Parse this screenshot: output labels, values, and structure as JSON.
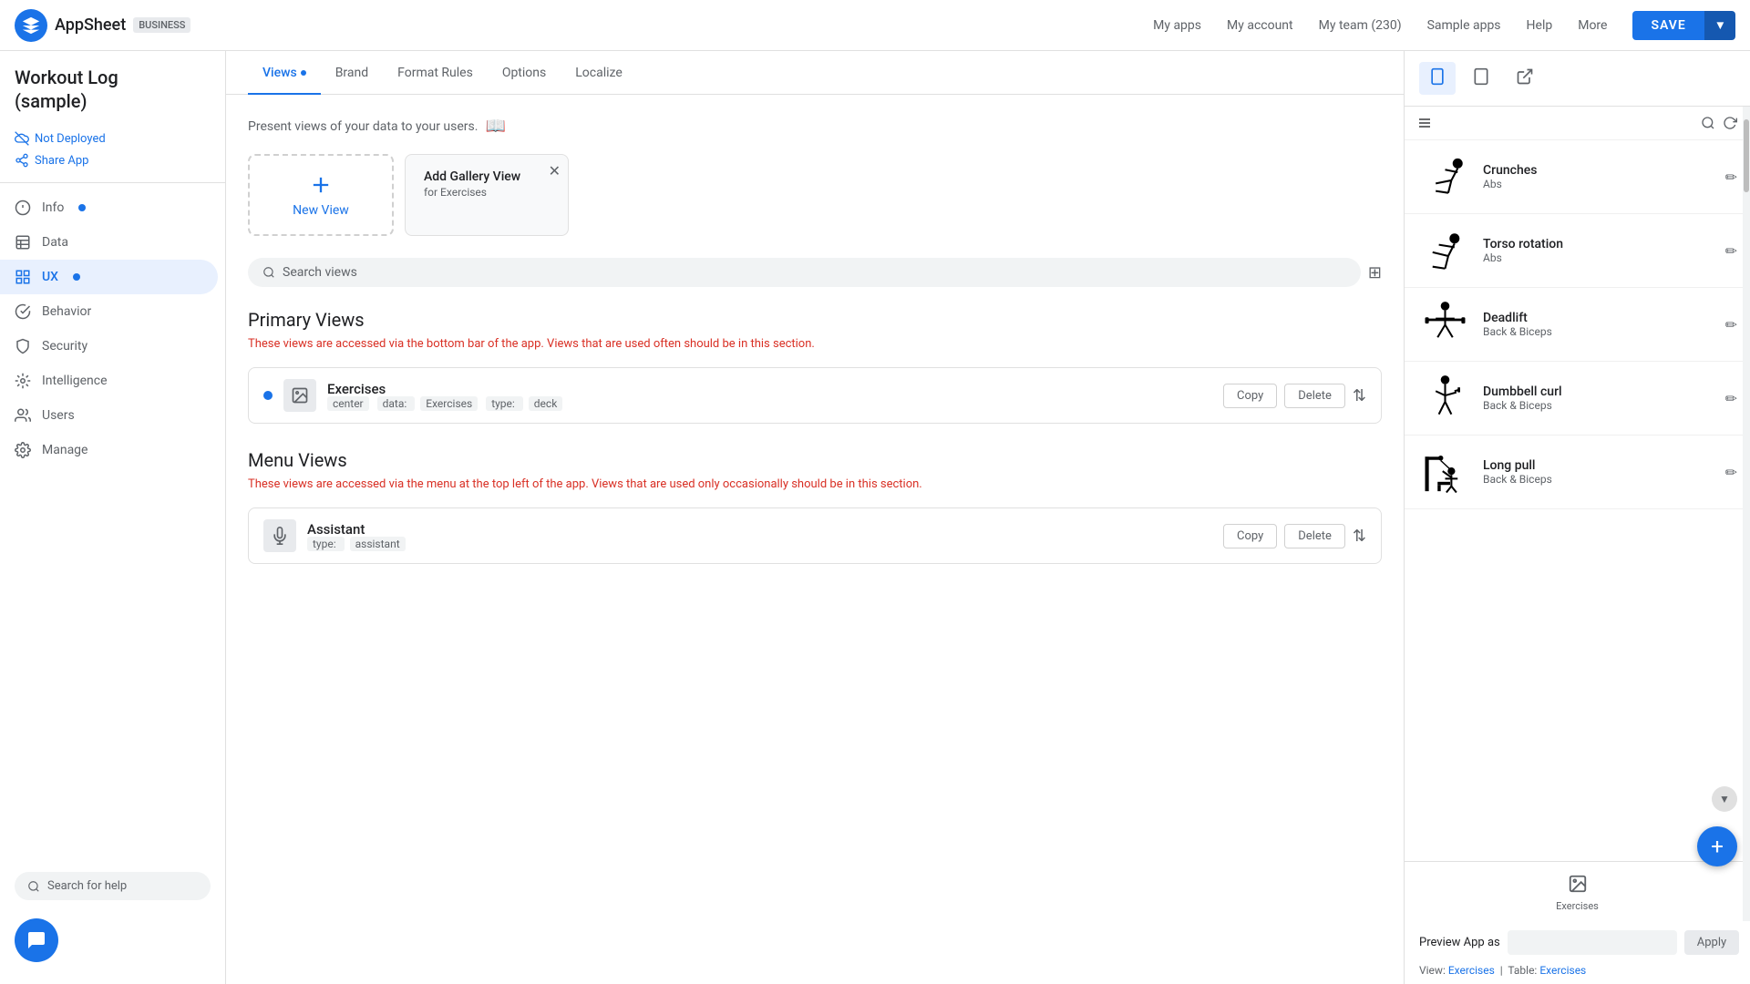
{
  "app": {
    "name": "Workout Log",
    "name_sub": "(sample)",
    "badge": "BUSINESS",
    "status": "Not Deployed",
    "share": "Share App"
  },
  "top_nav": {
    "my_apps": "My apps",
    "my_account": "My account",
    "my_team": "My team (230)",
    "sample_apps": "Sample apps",
    "help": "Help",
    "more": "More",
    "save": "SAVE"
  },
  "sidebar": {
    "items": [
      {
        "id": "info",
        "label": "Info",
        "has_dot": true
      },
      {
        "id": "data",
        "label": "Data",
        "has_dot": false
      },
      {
        "id": "ux",
        "label": "UX",
        "has_dot": true,
        "active": true
      },
      {
        "id": "behavior",
        "label": "Behavior",
        "has_dot": false
      },
      {
        "id": "security",
        "label": "Security",
        "has_dot": false
      },
      {
        "id": "intelligence",
        "label": "Intelligence",
        "has_dot": false
      },
      {
        "id": "users",
        "label": "Users",
        "has_dot": false
      },
      {
        "id": "manage",
        "label": "Manage",
        "has_dot": false
      }
    ],
    "search_placeholder": "Search for help"
  },
  "content": {
    "tabs": [
      {
        "id": "views",
        "label": "Views",
        "active": true,
        "has_dot": true
      },
      {
        "id": "brand",
        "label": "Brand",
        "active": false
      },
      {
        "id": "format_rules",
        "label": "Format Rules",
        "active": false
      },
      {
        "id": "options",
        "label": "Options",
        "active": false
      },
      {
        "id": "localize",
        "label": "Localize",
        "active": false
      }
    ],
    "description": "Present views of your data to your users.",
    "add_gallery_view": {
      "title": "Add Gallery View",
      "subtitle": "for Exercises"
    },
    "new_view_label": "New View",
    "search_placeholder": "Search views",
    "primary_views": {
      "title": "Primary Views",
      "description": "These views are accessed via the bottom bar of the app. Views that are used often should be in this section.",
      "items": [
        {
          "name": "Exercises",
          "center": "center",
          "data": "Exercises",
          "type": "deck",
          "has_dot": true
        }
      ]
    },
    "menu_views": {
      "title": "Menu Views",
      "description": "These views are accessed via the menu at the top left of the app. Views that are used only occasionally should be in this section.",
      "items": [
        {
          "name": "Assistant",
          "type": "assistant",
          "has_dot": false
        }
      ]
    }
  },
  "preview": {
    "exercises": [
      {
        "name": "Crunches",
        "category": "Abs",
        "icon_type": "crunches"
      },
      {
        "name": "Torso rotation",
        "category": "Abs",
        "icon_type": "torso"
      },
      {
        "name": "Deadlift",
        "category": "Back & Biceps",
        "icon_type": "deadlift"
      },
      {
        "name": "Dumbbell curl",
        "category": "Back & Biceps",
        "icon_type": "dumbbell"
      },
      {
        "name": "Long pull",
        "category": "Back & Biceps",
        "icon_type": "longpull"
      }
    ],
    "bottom_bar_label": "Exercises",
    "preview_as_label": "Preview App as",
    "apply_label": "Apply",
    "view_link": "View:",
    "view_name": "Exercises",
    "table_link": "Table:",
    "table_name": "Exercises"
  }
}
